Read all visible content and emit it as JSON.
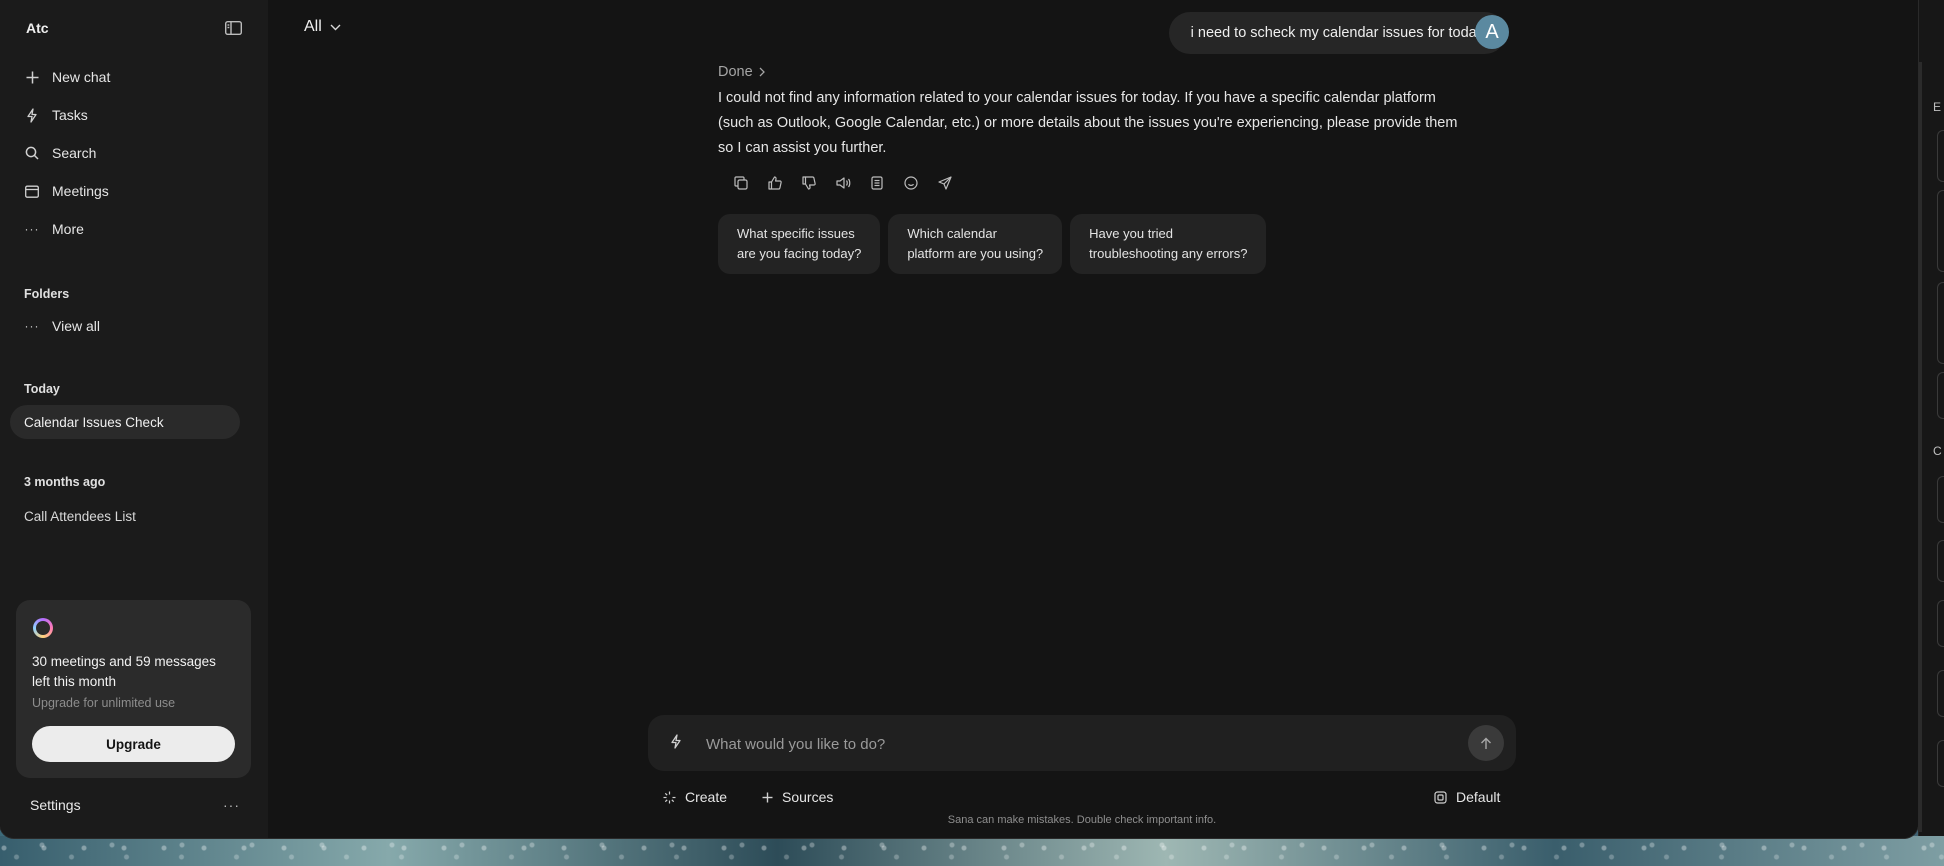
{
  "sidebar": {
    "workspace": "Atc",
    "nav": [
      {
        "label": "New chat",
        "icon": "plus-icon"
      },
      {
        "label": "Tasks",
        "icon": "bolt-icon"
      },
      {
        "label": "Search",
        "icon": "search-icon"
      },
      {
        "label": "Meetings",
        "icon": "calendar-icon"
      },
      {
        "label": "More",
        "icon": "more-dots-icon"
      }
    ],
    "folders_label": "Folders",
    "view_all": "View all",
    "today_label": "Today",
    "today_chats": [
      "Calendar Issues Check"
    ],
    "older_label": "3 months ago",
    "older_chats": [
      "Call Attendees List"
    ],
    "upgrade": {
      "text": "30 meetings and 59 messages left this month",
      "sub": "Upgrade for unlimited use",
      "button": "Upgrade"
    },
    "settings": "Settings",
    "settings_more": "···"
  },
  "header": {
    "filter": "All",
    "avatar_letter": "A"
  },
  "conversation": {
    "user_message": "i need to scheck my calendar issues for today",
    "status": "Done",
    "answer": "I could not find any information related to your calendar issues for today. If you have a specific calendar platform (such as Outlook, Google Calendar, etc.) or more details about the issues you're experiencing, please provide them so I can assist you further.",
    "suggestions": [
      "What specific issues\nare you facing today?",
      "Which calendar\nplatform are you using?",
      "Have you tried\ntroubleshooting any errors?"
    ]
  },
  "composer": {
    "placeholder": "What would you like to do?",
    "create": "Create",
    "sources": "Sources",
    "mode": "Default",
    "disclaimer": "Sana can make mistakes. Double check important info."
  },
  "right_edge": {
    "letters": [
      "E",
      "C"
    ]
  },
  "colors": {
    "background": "#141414",
    "sidebar": "#1b1b1b",
    "avatar": "#5b89a0",
    "upgrade_button": "#ececec"
  }
}
